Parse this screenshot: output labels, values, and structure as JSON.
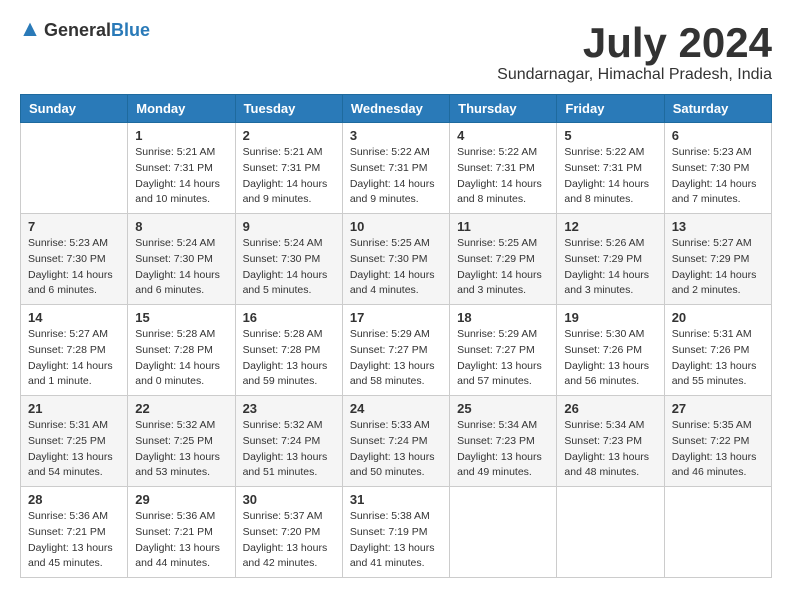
{
  "logo": {
    "text_general": "General",
    "text_blue": "Blue"
  },
  "title": "July 2024",
  "subtitle": "Sundarnagar, Himachal Pradesh, India",
  "weekdays": [
    "Sunday",
    "Monday",
    "Tuesday",
    "Wednesday",
    "Thursday",
    "Friday",
    "Saturday"
  ],
  "weeks": [
    [
      {
        "day": "",
        "sunrise": "",
        "sunset": "",
        "daylight": ""
      },
      {
        "day": "1",
        "sunrise": "Sunrise: 5:21 AM",
        "sunset": "Sunset: 7:31 PM",
        "daylight": "Daylight: 14 hours and 10 minutes."
      },
      {
        "day": "2",
        "sunrise": "Sunrise: 5:21 AM",
        "sunset": "Sunset: 7:31 PM",
        "daylight": "Daylight: 14 hours and 9 minutes."
      },
      {
        "day": "3",
        "sunrise": "Sunrise: 5:22 AM",
        "sunset": "Sunset: 7:31 PM",
        "daylight": "Daylight: 14 hours and 9 minutes."
      },
      {
        "day": "4",
        "sunrise": "Sunrise: 5:22 AM",
        "sunset": "Sunset: 7:31 PM",
        "daylight": "Daylight: 14 hours and 8 minutes."
      },
      {
        "day": "5",
        "sunrise": "Sunrise: 5:22 AM",
        "sunset": "Sunset: 7:31 PM",
        "daylight": "Daylight: 14 hours and 8 minutes."
      },
      {
        "day": "6",
        "sunrise": "Sunrise: 5:23 AM",
        "sunset": "Sunset: 7:30 PM",
        "daylight": "Daylight: 14 hours and 7 minutes."
      }
    ],
    [
      {
        "day": "7",
        "sunrise": "Sunrise: 5:23 AM",
        "sunset": "Sunset: 7:30 PM",
        "daylight": "Daylight: 14 hours and 6 minutes."
      },
      {
        "day": "8",
        "sunrise": "Sunrise: 5:24 AM",
        "sunset": "Sunset: 7:30 PM",
        "daylight": "Daylight: 14 hours and 6 minutes."
      },
      {
        "day": "9",
        "sunrise": "Sunrise: 5:24 AM",
        "sunset": "Sunset: 7:30 PM",
        "daylight": "Daylight: 14 hours and 5 minutes."
      },
      {
        "day": "10",
        "sunrise": "Sunrise: 5:25 AM",
        "sunset": "Sunset: 7:30 PM",
        "daylight": "Daylight: 14 hours and 4 minutes."
      },
      {
        "day": "11",
        "sunrise": "Sunrise: 5:25 AM",
        "sunset": "Sunset: 7:29 PM",
        "daylight": "Daylight: 14 hours and 3 minutes."
      },
      {
        "day": "12",
        "sunrise": "Sunrise: 5:26 AM",
        "sunset": "Sunset: 7:29 PM",
        "daylight": "Daylight: 14 hours and 3 minutes."
      },
      {
        "day": "13",
        "sunrise": "Sunrise: 5:27 AM",
        "sunset": "Sunset: 7:29 PM",
        "daylight": "Daylight: 14 hours and 2 minutes."
      }
    ],
    [
      {
        "day": "14",
        "sunrise": "Sunrise: 5:27 AM",
        "sunset": "Sunset: 7:28 PM",
        "daylight": "Daylight: 14 hours and 1 minute."
      },
      {
        "day": "15",
        "sunrise": "Sunrise: 5:28 AM",
        "sunset": "Sunset: 7:28 PM",
        "daylight": "Daylight: 14 hours and 0 minutes."
      },
      {
        "day": "16",
        "sunrise": "Sunrise: 5:28 AM",
        "sunset": "Sunset: 7:28 PM",
        "daylight": "Daylight: 13 hours and 59 minutes."
      },
      {
        "day": "17",
        "sunrise": "Sunrise: 5:29 AM",
        "sunset": "Sunset: 7:27 PM",
        "daylight": "Daylight: 13 hours and 58 minutes."
      },
      {
        "day": "18",
        "sunrise": "Sunrise: 5:29 AM",
        "sunset": "Sunset: 7:27 PM",
        "daylight": "Daylight: 13 hours and 57 minutes."
      },
      {
        "day": "19",
        "sunrise": "Sunrise: 5:30 AM",
        "sunset": "Sunset: 7:26 PM",
        "daylight": "Daylight: 13 hours and 56 minutes."
      },
      {
        "day": "20",
        "sunrise": "Sunrise: 5:31 AM",
        "sunset": "Sunset: 7:26 PM",
        "daylight": "Daylight: 13 hours and 55 minutes."
      }
    ],
    [
      {
        "day": "21",
        "sunrise": "Sunrise: 5:31 AM",
        "sunset": "Sunset: 7:25 PM",
        "daylight": "Daylight: 13 hours and 54 minutes."
      },
      {
        "day": "22",
        "sunrise": "Sunrise: 5:32 AM",
        "sunset": "Sunset: 7:25 PM",
        "daylight": "Daylight: 13 hours and 53 minutes."
      },
      {
        "day": "23",
        "sunrise": "Sunrise: 5:32 AM",
        "sunset": "Sunset: 7:24 PM",
        "daylight": "Daylight: 13 hours and 51 minutes."
      },
      {
        "day": "24",
        "sunrise": "Sunrise: 5:33 AM",
        "sunset": "Sunset: 7:24 PM",
        "daylight": "Daylight: 13 hours and 50 minutes."
      },
      {
        "day": "25",
        "sunrise": "Sunrise: 5:34 AM",
        "sunset": "Sunset: 7:23 PM",
        "daylight": "Daylight: 13 hours and 49 minutes."
      },
      {
        "day": "26",
        "sunrise": "Sunrise: 5:34 AM",
        "sunset": "Sunset: 7:23 PM",
        "daylight": "Daylight: 13 hours and 48 minutes."
      },
      {
        "day": "27",
        "sunrise": "Sunrise: 5:35 AM",
        "sunset": "Sunset: 7:22 PM",
        "daylight": "Daylight: 13 hours and 46 minutes."
      }
    ],
    [
      {
        "day": "28",
        "sunrise": "Sunrise: 5:36 AM",
        "sunset": "Sunset: 7:21 PM",
        "daylight": "Daylight: 13 hours and 45 minutes."
      },
      {
        "day": "29",
        "sunrise": "Sunrise: 5:36 AM",
        "sunset": "Sunset: 7:21 PM",
        "daylight": "Daylight: 13 hours and 44 minutes."
      },
      {
        "day": "30",
        "sunrise": "Sunrise: 5:37 AM",
        "sunset": "Sunset: 7:20 PM",
        "daylight": "Daylight: 13 hours and 42 minutes."
      },
      {
        "day": "31",
        "sunrise": "Sunrise: 5:38 AM",
        "sunset": "Sunset: 7:19 PM",
        "daylight": "Daylight: 13 hours and 41 minutes."
      },
      {
        "day": "",
        "sunrise": "",
        "sunset": "",
        "daylight": ""
      },
      {
        "day": "",
        "sunrise": "",
        "sunset": "",
        "daylight": ""
      },
      {
        "day": "",
        "sunrise": "",
        "sunset": "",
        "daylight": ""
      }
    ]
  ]
}
